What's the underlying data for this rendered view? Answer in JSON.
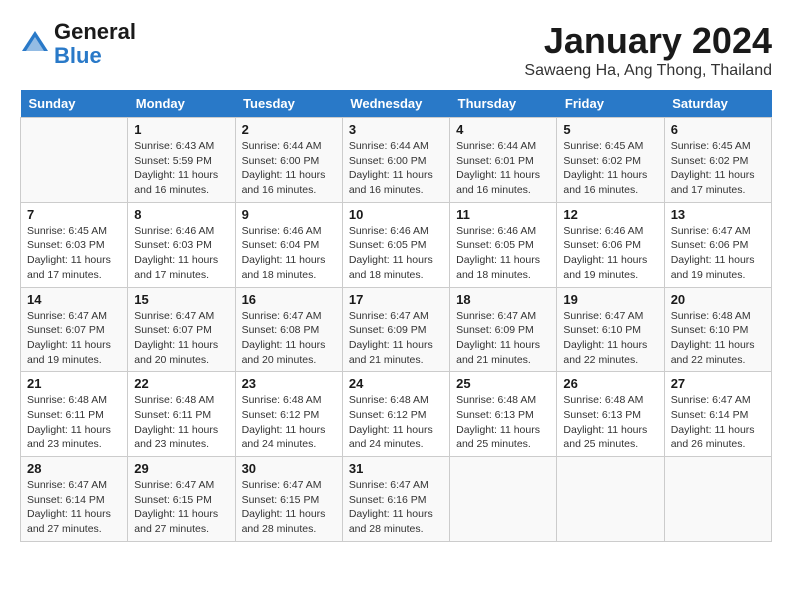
{
  "logo": {
    "line1": "General",
    "line2": "Blue"
  },
  "title": "January 2024",
  "subtitle": "Sawaeng Ha, Ang Thong, Thailand",
  "days_header": [
    "Sunday",
    "Monday",
    "Tuesday",
    "Wednesday",
    "Thursday",
    "Friday",
    "Saturday"
  ],
  "weeks": [
    [
      {
        "day": "",
        "sunrise": "",
        "sunset": "",
        "daylight": ""
      },
      {
        "day": "1",
        "sunrise": "Sunrise: 6:43 AM",
        "sunset": "Sunset: 5:59 PM",
        "daylight": "Daylight: 11 hours and 16 minutes."
      },
      {
        "day": "2",
        "sunrise": "Sunrise: 6:44 AM",
        "sunset": "Sunset: 6:00 PM",
        "daylight": "Daylight: 11 hours and 16 minutes."
      },
      {
        "day": "3",
        "sunrise": "Sunrise: 6:44 AM",
        "sunset": "Sunset: 6:00 PM",
        "daylight": "Daylight: 11 hours and 16 minutes."
      },
      {
        "day": "4",
        "sunrise": "Sunrise: 6:44 AM",
        "sunset": "Sunset: 6:01 PM",
        "daylight": "Daylight: 11 hours and 16 minutes."
      },
      {
        "day": "5",
        "sunrise": "Sunrise: 6:45 AM",
        "sunset": "Sunset: 6:02 PM",
        "daylight": "Daylight: 11 hours and 16 minutes."
      },
      {
        "day": "6",
        "sunrise": "Sunrise: 6:45 AM",
        "sunset": "Sunset: 6:02 PM",
        "daylight": "Daylight: 11 hours and 17 minutes."
      }
    ],
    [
      {
        "day": "7",
        "sunrise": "Sunrise: 6:45 AM",
        "sunset": "Sunset: 6:03 PM",
        "daylight": "Daylight: 11 hours and 17 minutes."
      },
      {
        "day": "8",
        "sunrise": "Sunrise: 6:46 AM",
        "sunset": "Sunset: 6:03 PM",
        "daylight": "Daylight: 11 hours and 17 minutes."
      },
      {
        "day": "9",
        "sunrise": "Sunrise: 6:46 AM",
        "sunset": "Sunset: 6:04 PM",
        "daylight": "Daylight: 11 hours and 18 minutes."
      },
      {
        "day": "10",
        "sunrise": "Sunrise: 6:46 AM",
        "sunset": "Sunset: 6:05 PM",
        "daylight": "Daylight: 11 hours and 18 minutes."
      },
      {
        "day": "11",
        "sunrise": "Sunrise: 6:46 AM",
        "sunset": "Sunset: 6:05 PM",
        "daylight": "Daylight: 11 hours and 18 minutes."
      },
      {
        "day": "12",
        "sunrise": "Sunrise: 6:46 AM",
        "sunset": "Sunset: 6:06 PM",
        "daylight": "Daylight: 11 hours and 19 minutes."
      },
      {
        "day": "13",
        "sunrise": "Sunrise: 6:47 AM",
        "sunset": "Sunset: 6:06 PM",
        "daylight": "Daylight: 11 hours and 19 minutes."
      }
    ],
    [
      {
        "day": "14",
        "sunrise": "Sunrise: 6:47 AM",
        "sunset": "Sunset: 6:07 PM",
        "daylight": "Daylight: 11 hours and 19 minutes."
      },
      {
        "day": "15",
        "sunrise": "Sunrise: 6:47 AM",
        "sunset": "Sunset: 6:07 PM",
        "daylight": "Daylight: 11 hours and 20 minutes."
      },
      {
        "day": "16",
        "sunrise": "Sunrise: 6:47 AM",
        "sunset": "Sunset: 6:08 PM",
        "daylight": "Daylight: 11 hours and 20 minutes."
      },
      {
        "day": "17",
        "sunrise": "Sunrise: 6:47 AM",
        "sunset": "Sunset: 6:09 PM",
        "daylight": "Daylight: 11 hours and 21 minutes."
      },
      {
        "day": "18",
        "sunrise": "Sunrise: 6:47 AM",
        "sunset": "Sunset: 6:09 PM",
        "daylight": "Daylight: 11 hours and 21 minutes."
      },
      {
        "day": "19",
        "sunrise": "Sunrise: 6:47 AM",
        "sunset": "Sunset: 6:10 PM",
        "daylight": "Daylight: 11 hours and 22 minutes."
      },
      {
        "day": "20",
        "sunrise": "Sunrise: 6:48 AM",
        "sunset": "Sunset: 6:10 PM",
        "daylight": "Daylight: 11 hours and 22 minutes."
      }
    ],
    [
      {
        "day": "21",
        "sunrise": "Sunrise: 6:48 AM",
        "sunset": "Sunset: 6:11 PM",
        "daylight": "Daylight: 11 hours and 23 minutes."
      },
      {
        "day": "22",
        "sunrise": "Sunrise: 6:48 AM",
        "sunset": "Sunset: 6:11 PM",
        "daylight": "Daylight: 11 hours and 23 minutes."
      },
      {
        "day": "23",
        "sunrise": "Sunrise: 6:48 AM",
        "sunset": "Sunset: 6:12 PM",
        "daylight": "Daylight: 11 hours and 24 minutes."
      },
      {
        "day": "24",
        "sunrise": "Sunrise: 6:48 AM",
        "sunset": "Sunset: 6:12 PM",
        "daylight": "Daylight: 11 hours and 24 minutes."
      },
      {
        "day": "25",
        "sunrise": "Sunrise: 6:48 AM",
        "sunset": "Sunset: 6:13 PM",
        "daylight": "Daylight: 11 hours and 25 minutes."
      },
      {
        "day": "26",
        "sunrise": "Sunrise: 6:48 AM",
        "sunset": "Sunset: 6:13 PM",
        "daylight": "Daylight: 11 hours and 25 minutes."
      },
      {
        "day": "27",
        "sunrise": "Sunrise: 6:47 AM",
        "sunset": "Sunset: 6:14 PM",
        "daylight": "Daylight: 11 hours and 26 minutes."
      }
    ],
    [
      {
        "day": "28",
        "sunrise": "Sunrise: 6:47 AM",
        "sunset": "Sunset: 6:14 PM",
        "daylight": "Daylight: 11 hours and 27 minutes."
      },
      {
        "day": "29",
        "sunrise": "Sunrise: 6:47 AM",
        "sunset": "Sunset: 6:15 PM",
        "daylight": "Daylight: 11 hours and 27 minutes."
      },
      {
        "day": "30",
        "sunrise": "Sunrise: 6:47 AM",
        "sunset": "Sunset: 6:15 PM",
        "daylight": "Daylight: 11 hours and 28 minutes."
      },
      {
        "day": "31",
        "sunrise": "Sunrise: 6:47 AM",
        "sunset": "Sunset: 6:16 PM",
        "daylight": "Daylight: 11 hours and 28 minutes."
      },
      {
        "day": "",
        "sunrise": "",
        "sunset": "",
        "daylight": ""
      },
      {
        "day": "",
        "sunrise": "",
        "sunset": "",
        "daylight": ""
      },
      {
        "day": "",
        "sunrise": "",
        "sunset": "",
        "daylight": ""
      }
    ]
  ]
}
